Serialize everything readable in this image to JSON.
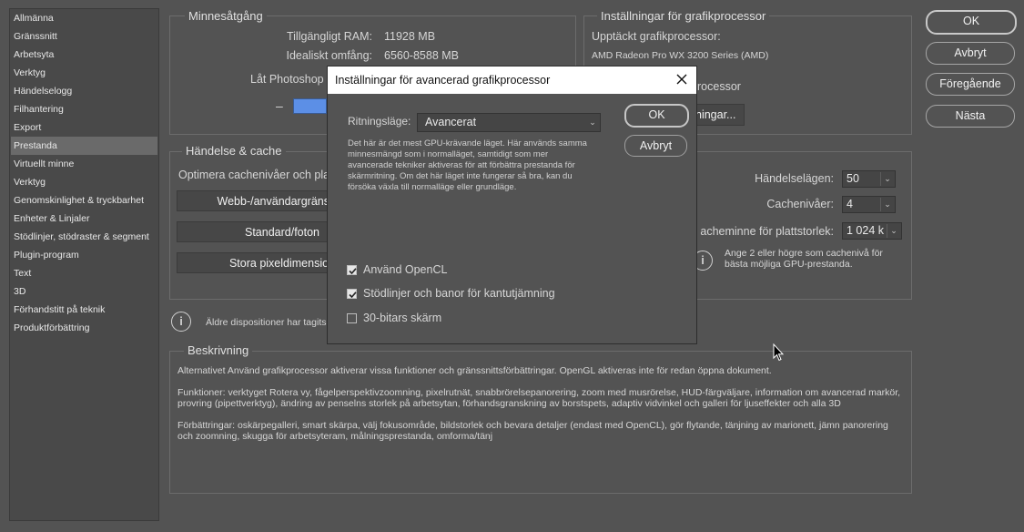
{
  "sidebar": {
    "items": [
      {
        "label": "Allmänna",
        "active": false
      },
      {
        "label": "Gränssnitt",
        "active": false
      },
      {
        "label": "Arbetsyta",
        "active": false
      },
      {
        "label": "Verktyg",
        "active": false
      },
      {
        "label": "Händelselogg",
        "active": false
      },
      {
        "label": "Filhantering",
        "active": false
      },
      {
        "label": "Export",
        "active": false
      },
      {
        "label": "Prestanda",
        "active": true
      },
      {
        "label": "Virtuellt minne",
        "active": false
      },
      {
        "label": "Verktyg",
        "active": false
      },
      {
        "label": "Genomskinlighet & tryckbarhet",
        "active": false
      },
      {
        "label": "Enheter & Linjaler",
        "active": false
      },
      {
        "label": "Stödlinjer, stödraster & segment",
        "active": false
      },
      {
        "label": "Plugin-program",
        "active": false
      },
      {
        "label": "Text",
        "active": false
      },
      {
        "label": "3D",
        "active": false
      },
      {
        "label": "Förhandstitt på teknik",
        "active": false
      },
      {
        "label": "Produktförbättring",
        "active": false
      }
    ]
  },
  "memory": {
    "title": "Minnesåtgång",
    "available_label": "Tillgängligt RAM:",
    "available_value": "11928 MB",
    "ideal_label": "Idealiskt omfång:",
    "ideal_value": "6560-8588 MB",
    "let_label": "Låt Photoshop",
    "minus": "–"
  },
  "gpu": {
    "title": "Inställningar för grafikprocessor",
    "detected_label": "Upptäckt grafikprocessor:",
    "detected_value": "AMD Radeon Pro WX 3200 Series (AMD)",
    "use_label_partial": "rocessor",
    "settings_button_partial": "ningar..."
  },
  "cache": {
    "title": "Händelse & cache",
    "optimize_label": "Optimera cachenivåer och pla",
    "btn_web": "Webb-/användargränssnit",
    "btn_standard": "Standard/foton",
    "btn_large": "Stora pixeldimension",
    "history_label": "Händelselägen:",
    "history_value": "50",
    "levels_label": "Cachenivåer:",
    "levels_value": "4",
    "tile_label": "acheminne för plattstorlek:",
    "tile_value": "1 024 k",
    "hint": "Ange 2 eller högre som cachenivå för bästa möjliga GPU-prestanda."
  },
  "legacy_note": "Äldre dispositioner har tagits b",
  "description": {
    "title": "Beskrivning",
    "p1": "Alternativet Använd grafikprocessor aktiverar vissa funktioner och gränssnittsförbättringar. OpenGL aktiveras inte för redan öppna dokument.",
    "p2": "Funktioner: verktyget Rotera vy, fågelperspektivzoomning, pixelrutnät, snabbrörelsepanorering, zoom med musrörelse, HUD-färgväljare, information om avancerad markör, provring (pipettverktyg), ändring av penselns storlek på arbetsytan, förhandsgranskning av borstspets, adaptiv vidvinkel och galleri för ljuseffekter och alla 3D",
    "p3": "Förbättringar: oskärpegalleri, smart skärpa, välj fokusområde, bildstorlek och bevara detaljer (endast med OpenCL), gör flytande, tänjning av marionett, jämn panorering och zoomning, skugga för arbetsyteram, målningsprestanda, omforma/tänj"
  },
  "buttons": {
    "ok": "OK",
    "cancel": "Avbryt",
    "prev": "Föregående",
    "next": "Nästa"
  },
  "dialog": {
    "title": "Inställningar för avancerad grafikprocessor",
    "mode_label": "Ritningsläge:",
    "mode_value": "Avancerat",
    "mode_desc": "Det här är det mest GPU-krävande läget. Här används samma minnesmängd som i normalläget, samtidigt som mer avancerade tekniker aktiveras för att förbättra prestanda för skärmritning. Om det här läget inte fungerar så bra, kan du försöka växla till normalläge eller grundläge.",
    "ok": "OK",
    "cancel": "Avbryt",
    "opt_opencl": "Använd OpenCL",
    "opt_opencl_checked": true,
    "opt_antialias": "Stödlinjer och banor för kantutjämning",
    "opt_antialias_checked": true,
    "opt_30bit": "30-bitars skärm",
    "opt_30bit_checked": false
  },
  "colors": {
    "background": "#535353",
    "accent_bar": "#5c8fe6"
  }
}
